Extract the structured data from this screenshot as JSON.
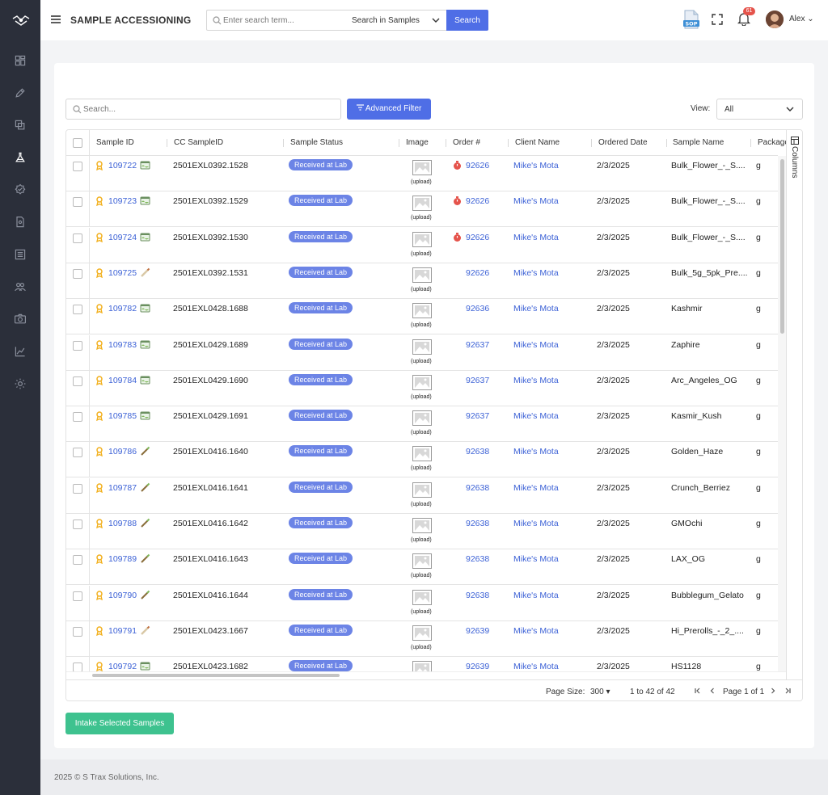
{
  "app": {
    "title": "SAMPLE ACCESSIONING"
  },
  "header": {
    "search_placeholder": "Enter search term...",
    "search_scope": "Search in Samples",
    "search_button": "Search",
    "sop_label": "SOP",
    "notification_count": "61",
    "user_name": "Alex"
  },
  "sidebar": {
    "items": [
      "dashboard-icon",
      "pencil-icon",
      "copy-icon",
      "flask-icon",
      "badge-icon",
      "document-icon",
      "list-icon",
      "users-icon",
      "camera-icon",
      "chart-icon",
      "settings-icon"
    ],
    "active": "flask-icon"
  },
  "toolbar": {
    "search_placeholder": "Search...",
    "advanced_filter": "Advanced Filter",
    "view_label": "View:",
    "view_value": "All"
  },
  "columns": [
    "Sample ID",
    "CC SampleID",
    "Sample Status",
    "Image",
    "Order #",
    "Client Name",
    "Ordered Date",
    "Sample Name",
    "Package"
  ],
  "columns_panel_label": "Columns",
  "upload_label": "(upload)",
  "rows": [
    {
      "id": "109722",
      "icon": "tray",
      "cc": "2501EXL0392.1528",
      "status": "Received at Lab",
      "rush": true,
      "order": "92626",
      "client": "Mike's Mota",
      "date": "2/3/2025",
      "name": "Bulk_Flower_-_S....",
      "pkg": "g"
    },
    {
      "id": "109723",
      "icon": "tray",
      "cc": "2501EXL0392.1529",
      "status": "Received at Lab",
      "rush": true,
      "order": "92626",
      "client": "Mike's Mota",
      "date": "2/3/2025",
      "name": "Bulk_Flower_-_S....",
      "pkg": "g"
    },
    {
      "id": "109724",
      "icon": "tray",
      "cc": "2501EXL0392.1530",
      "status": "Received at Lab",
      "rush": true,
      "order": "92626",
      "client": "Mike's Mota",
      "date": "2/3/2025",
      "name": "Bulk_Flower_-_S....",
      "pkg": "g"
    },
    {
      "id": "109725",
      "icon": "preroll",
      "cc": "2501EXL0392.1531",
      "status": "Received at Lab",
      "rush": false,
      "order": "92626",
      "client": "Mike's Mota",
      "date": "2/3/2025",
      "name": "Bulk_5g_5pk_Pre....",
      "pkg": "g"
    },
    {
      "id": "109782",
      "icon": "tray",
      "cc": "2501EXL0428.1688",
      "status": "Received at Lab",
      "rush": false,
      "order": "92636",
      "client": "Mike's Mota",
      "date": "2/3/2025",
      "name": "Kashmir",
      "pkg": "g"
    },
    {
      "id": "109783",
      "icon": "tray",
      "cc": "2501EXL0429.1689",
      "status": "Received at Lab",
      "rush": false,
      "order": "92637",
      "client": "Mike's Mota",
      "date": "2/3/2025",
      "name": "Zaphire",
      "pkg": "g"
    },
    {
      "id": "109784",
      "icon": "tray",
      "cc": "2501EXL0429.1690",
      "status": "Received at Lab",
      "rush": false,
      "order": "92637",
      "client": "Mike's Mota",
      "date": "2/3/2025",
      "name": "Arc_Angeles_OG",
      "pkg": "g"
    },
    {
      "id": "109785",
      "icon": "tray",
      "cc": "2501EXL0429.1691",
      "status": "Received at Lab",
      "rush": false,
      "order": "92637",
      "client": "Mike's Mota",
      "date": "2/3/2025",
      "name": "Kasmir_Kush",
      "pkg": "g"
    },
    {
      "id": "109786",
      "icon": "vape",
      "cc": "2501EXL0416.1640",
      "status": "Received at Lab",
      "rush": false,
      "order": "92638",
      "client": "Mike's Mota",
      "date": "2/3/2025",
      "name": "Golden_Haze",
      "pkg": "g"
    },
    {
      "id": "109787",
      "icon": "vape",
      "cc": "2501EXL0416.1641",
      "status": "Received at Lab",
      "rush": false,
      "order": "92638",
      "client": "Mike's Mota",
      "date": "2/3/2025",
      "name": "Crunch_Berriez",
      "pkg": "g"
    },
    {
      "id": "109788",
      "icon": "vape",
      "cc": "2501EXL0416.1642",
      "status": "Received at Lab",
      "rush": false,
      "order": "92638",
      "client": "Mike's Mota",
      "date": "2/3/2025",
      "name": "GMOchi",
      "pkg": "g"
    },
    {
      "id": "109789",
      "icon": "vape",
      "cc": "2501EXL0416.1643",
      "status": "Received at Lab",
      "rush": false,
      "order": "92638",
      "client": "Mike's Mota",
      "date": "2/3/2025",
      "name": "LAX_OG",
      "pkg": "g"
    },
    {
      "id": "109790",
      "icon": "vape",
      "cc": "2501EXL0416.1644",
      "status": "Received at Lab",
      "rush": false,
      "order": "92638",
      "client": "Mike's Mota",
      "date": "2/3/2025",
      "name": "Bubblegum_Gelato",
      "pkg": "g"
    },
    {
      "id": "109791",
      "icon": "preroll",
      "cc": "2501EXL0423.1667",
      "status": "Received at Lab",
      "rush": false,
      "order": "92639",
      "client": "Mike's Mota",
      "date": "2/3/2025",
      "name": "Hi_Prerolls_-_2_....",
      "pkg": "g"
    },
    {
      "id": "109792",
      "icon": "tray",
      "cc": "2501EXL0423.1682",
      "status": "Received at Lab",
      "rush": false,
      "order": "92639",
      "client": "Mike's Mota",
      "date": "2/3/2025",
      "name": "HS1128",
      "pkg": "g"
    }
  ],
  "pagination": {
    "page_size_label": "Page Size:",
    "page_size": "300",
    "range": "1 to 42 of 42",
    "page_info": "Page 1 of 1"
  },
  "actions": {
    "intake": "Intake Selected Samples"
  },
  "footer": {
    "copyright": "2025 © S Trax Solutions, Inc."
  },
  "colors": {
    "primary": "#4f6ee6",
    "status_pill": "#6c84e6",
    "link": "#3d62d6",
    "intake": "#3ec28f",
    "sidebar": "#2b2f3a",
    "rush": "#e5534b",
    "ribbon": "#f2b01e"
  }
}
